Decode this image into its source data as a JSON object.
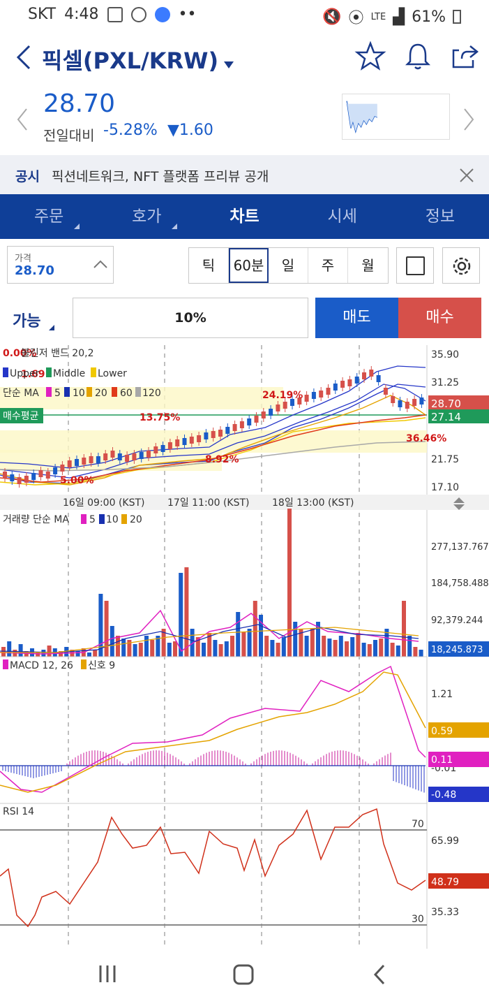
{
  "status": {
    "carrier": "SKT",
    "time": "4:48",
    "battery": "61%",
    "network": "LTE"
  },
  "header": {
    "title": "픽셀(PXL/KRW)"
  },
  "quote": {
    "price": "28.70",
    "change_label": "전일대비",
    "change_pct": "-5.28%",
    "change_abs": "1.60"
  },
  "notice": {
    "tag": "공시",
    "text": "픽션네트워크, NFT 플랫폼 프리뷰 공개"
  },
  "tabs": [
    "주문",
    "호가",
    "차트",
    "시세",
    "정보"
  ],
  "tabs_active": "차트",
  "price_box": {
    "label": "가격",
    "value": "28.70"
  },
  "periods": [
    "틱",
    "60분",
    "일",
    "주",
    "월"
  ],
  "period_selected": "60분",
  "order": {
    "possible": "가능",
    "percent": "10%",
    "sell": "매도",
    "buy": "매수"
  },
  "chart": {
    "bb_label": "볼린저 밴드 20,2",
    "legend_bb": [
      "Upper",
      "Middle",
      "Lower"
    ],
    "ma_label": "단순 MA",
    "ma_periods": [
      "5",
      "10",
      "20",
      "60",
      "120"
    ],
    "avg_label": "매수평균",
    "price_axis": [
      "35.90",
      "31.25",
      "21.75",
      "17.10"
    ],
    "price_tags": {
      "current": "28.70",
      "avg": "27.14"
    },
    "annotations": [
      "0.00%",
      "1.69",
      "24.19%",
      "13.75%",
      "36.46%",
      "8.92%",
      "5.00%"
    ],
    "dates": [
      "16일 09:00 (KST)",
      "17일 11:00 (KST)",
      "18일 13:00 (KST)"
    ],
    "vol_label": "거래량 단순 MA",
    "vol_periods": [
      "5",
      "10",
      "20"
    ],
    "vol_axis": [
      "277,137.767",
      "184,758.488",
      "92,379.244"
    ],
    "vol_current": "18,245.873",
    "macd_label": "MACD 12, 26",
    "macd_signal": "신호 9",
    "macd_axis": [
      "1.21",
      "-0.01"
    ],
    "macd_tags": [
      "0.59",
      "0.11",
      "-0.48"
    ],
    "rsi_label": "RSI 14",
    "rsi_axis": [
      "70",
      "65.99",
      "35.33",
      "30"
    ],
    "rsi_current": "48.79"
  },
  "colors": {
    "navy": "#0f3f98",
    "blue": "#1a5cc8",
    "red": "#d6504a",
    "green": "#1f9a5a"
  }
}
